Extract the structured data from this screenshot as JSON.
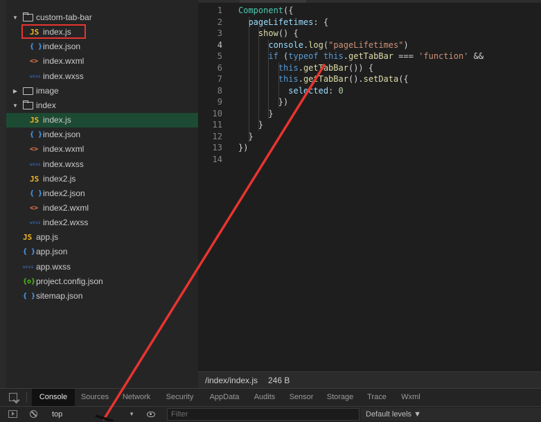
{
  "explorer": {
    "items": [
      {
        "label": "custom-tab-bar",
        "type": "folder",
        "open": true,
        "depth": 0
      },
      {
        "label": "index.js",
        "type": "js",
        "depth": 1,
        "highlighted": true
      },
      {
        "label": "index.json",
        "type": "json",
        "depth": 1
      },
      {
        "label": "index.wxml",
        "type": "wxml",
        "depth": 1
      },
      {
        "label": "index.wxss",
        "type": "wxss",
        "depth": 1
      },
      {
        "label": "image",
        "type": "folder",
        "open": false,
        "depth": 0
      },
      {
        "label": "index",
        "type": "folder",
        "open": true,
        "depth": 0
      },
      {
        "label": "index.js",
        "type": "js",
        "depth": 1,
        "selected": true
      },
      {
        "label": "index.json",
        "type": "json",
        "depth": 1
      },
      {
        "label": "index.wxml",
        "type": "wxml",
        "depth": 1
      },
      {
        "label": "index.wxss",
        "type": "wxss",
        "depth": 1
      },
      {
        "label": "index2.js",
        "type": "js",
        "depth": 1
      },
      {
        "label": "index2.json",
        "type": "json",
        "depth": 1
      },
      {
        "label": "index2.wxml",
        "type": "wxml",
        "depth": 1
      },
      {
        "label": "index2.wxss",
        "type": "wxss",
        "depth": 1
      },
      {
        "label": "app.js",
        "type": "js",
        "depth": 0.5
      },
      {
        "label": "app.json",
        "type": "json",
        "depth": 0.5
      },
      {
        "label": "app.wxss",
        "type": "wxss",
        "depth": 0.5
      },
      {
        "label": "project.config.json",
        "type": "cfg",
        "depth": 0.5
      },
      {
        "label": "sitemap.json",
        "type": "json",
        "depth": 0.5
      }
    ],
    "icons": {
      "js": "JS",
      "json": "{ }",
      "wxml": "<>",
      "wxss": "wxss",
      "cfg": "{o}"
    }
  },
  "editor": {
    "active_line": 4,
    "lines": [
      [
        [
          "t-cmp",
          "Component"
        ],
        [
          "t-plain",
          "({"
        ]
      ],
      [
        [
          "t-plain",
          "  "
        ],
        [
          "t-def",
          "pageLifetimes"
        ],
        [
          "t-plain",
          ": {"
        ]
      ],
      [
        [
          "t-plain",
          "    "
        ],
        [
          "t-fn",
          "show"
        ],
        [
          "t-plain",
          "() {"
        ]
      ],
      [
        [
          "t-plain",
          "      "
        ],
        [
          "t-def",
          "console"
        ],
        [
          "t-plain",
          "."
        ],
        [
          "t-fn",
          "log"
        ],
        [
          "t-plain",
          "("
        ],
        [
          "t-str",
          "\"pageLifetimes\""
        ],
        [
          "t-plain",
          ")"
        ]
      ],
      [
        [
          "t-plain",
          "      "
        ],
        [
          "t-kw",
          "if"
        ],
        [
          "t-plain",
          " ("
        ],
        [
          "t-kw",
          "typeof"
        ],
        [
          "t-plain",
          " "
        ],
        [
          "t-kw",
          "this"
        ],
        [
          "t-plain",
          "."
        ],
        [
          "t-fn",
          "getTabBar"
        ],
        [
          "t-plain",
          " === "
        ],
        [
          "t-str",
          "'function'"
        ],
        [
          "t-plain",
          " &&"
        ]
      ],
      [
        [
          "t-plain",
          "        "
        ],
        [
          "t-kw",
          "this"
        ],
        [
          "t-plain",
          "."
        ],
        [
          "t-fn",
          "getTabBar"
        ],
        [
          "t-plain",
          "()) {"
        ]
      ],
      [
        [
          "t-plain",
          "        "
        ],
        [
          "t-kw",
          "this"
        ],
        [
          "t-plain",
          "."
        ],
        [
          "t-fn",
          "getTabBar"
        ],
        [
          "t-plain",
          "()."
        ],
        [
          "t-fn",
          "setData"
        ],
        [
          "t-plain",
          "({"
        ]
      ],
      [
        [
          "t-plain",
          "          "
        ],
        [
          "t-def",
          "selected"
        ],
        [
          "t-plain",
          ": "
        ],
        [
          "t-num",
          "0"
        ]
      ],
      [
        [
          "t-plain",
          "        })"
        ]
      ],
      [
        [
          "t-plain",
          "      }"
        ]
      ],
      [
        [
          "t-plain",
          "    }"
        ]
      ],
      [
        [
          "t-plain",
          "  }"
        ]
      ],
      [
        [
          "t-plain",
          "})"
        ]
      ],
      [
        [
          "t-plain",
          ""
        ]
      ]
    ]
  },
  "status_bar": {
    "path": "/index/index.js",
    "size": "246 B"
  },
  "devtools": {
    "tabs": [
      "Console",
      "Sources",
      "Network",
      "Security",
      "AppData",
      "Audits",
      "Sensor",
      "Storage",
      "Trace",
      "Wxml"
    ],
    "active_tab": "Console",
    "context": "top",
    "filter_placeholder": "Filter",
    "levels_label": "Default levels ▼"
  },
  "colors": {
    "selection": "#1d4a33",
    "annotation_red": "#e8342f"
  }
}
